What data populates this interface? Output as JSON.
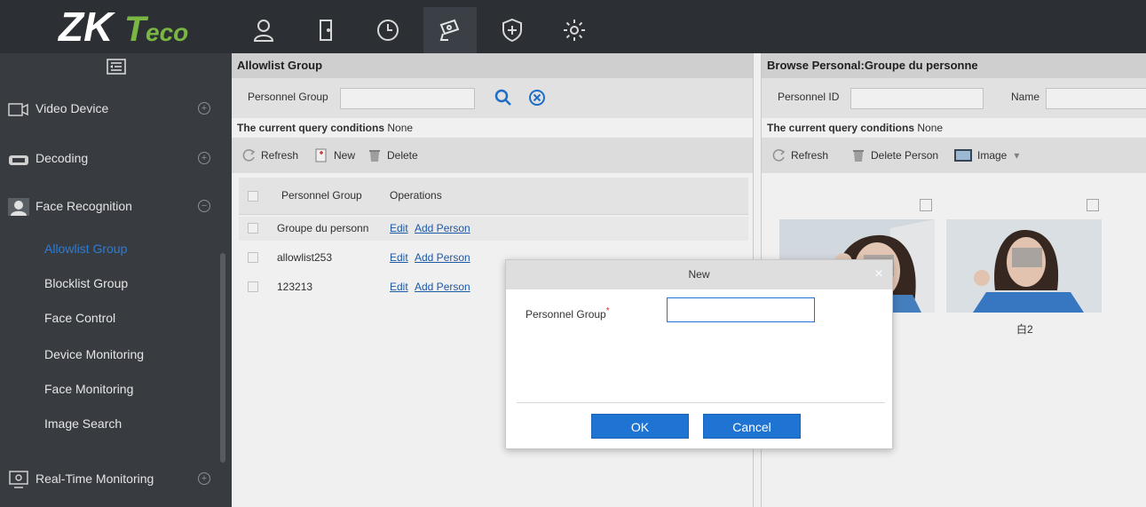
{
  "brand": {
    "logo_text": "ZKTeco"
  },
  "topnav": {
    "items": [
      {
        "icon": "person-icon"
      },
      {
        "icon": "door-icon"
      },
      {
        "icon": "clock-icon"
      },
      {
        "icon": "camera-icon",
        "active": true
      },
      {
        "icon": "shield-icon"
      },
      {
        "icon": "gear-icon"
      }
    ]
  },
  "sidebar": {
    "sections": [
      {
        "label": "Video Device",
        "icon": "video-device-icon",
        "toggle": "+"
      },
      {
        "label": "Decoding",
        "icon": "decoding-icon",
        "toggle": "+"
      },
      {
        "label": "Face Recognition",
        "icon": "face-recognition-icon",
        "toggle": "−"
      },
      {
        "label": "Real-Time Monitoring",
        "icon": "monitor-icon",
        "toggle": "+"
      }
    ],
    "sub_items": [
      "Allowlist Group",
      "Blocklist Group",
      "Face Control",
      "Device Monitoring",
      "Face Monitoring",
      "Image Search"
    ],
    "active_sub": "Allowlist Group"
  },
  "left_panel": {
    "title": "Allowlist Group",
    "search_label": "Personnel Group",
    "search_value": "",
    "conditions_label": "The current query conditions",
    "conditions_value": "None",
    "toolbar": {
      "refresh": "Refresh",
      "new": "New",
      "delete": "Delete"
    },
    "table": {
      "headers": [
        "Personnel Group",
        "Operations"
      ],
      "rows": [
        {
          "group": "Groupe du personn",
          "edit": "Edit",
          "add": "Add Person"
        },
        {
          "group": "allowlist253",
          "edit": "Edit",
          "add": "Add Person"
        },
        {
          "group": "123213",
          "edit": "Edit",
          "add": "Add Person"
        }
      ]
    }
  },
  "right_panel": {
    "title": "Browse Personal:Groupe du personne",
    "id_label": "Personnel ID",
    "name_label": "Name",
    "conditions_label": "The current query conditions",
    "conditions_value": "None",
    "toolbar": {
      "refresh": "Refresh",
      "delete_person": "Delete Person",
      "image": "Image",
      "image_caret": "▾"
    },
    "photos": [
      {
        "name": ""
      },
      {
        "name": "白2"
      }
    ]
  },
  "modal": {
    "title": "New",
    "close": "×",
    "field_label": "Personnel Group",
    "required_mark": "*",
    "field_value": "",
    "ok": "OK",
    "cancel": "Cancel"
  },
  "colors": {
    "accent": "#1f74d3",
    "sidebar_bg": "#383c41",
    "topbar_bg": "#2c2f33",
    "active_link": "#2d7bd5"
  }
}
